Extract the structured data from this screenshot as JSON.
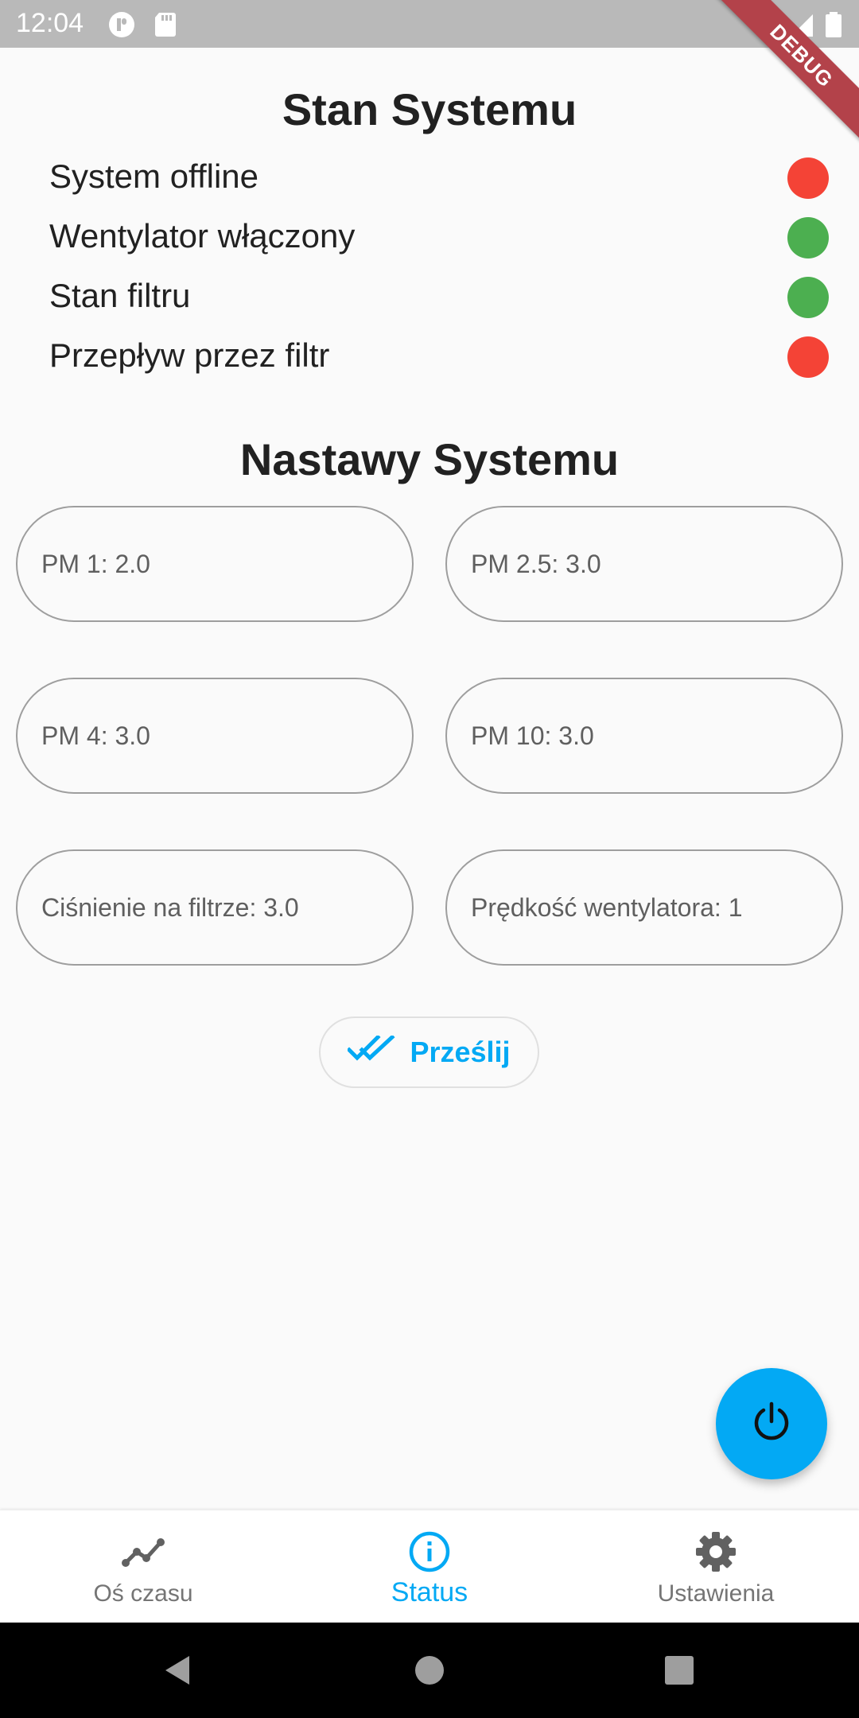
{
  "status_bar": {
    "time": "12:04",
    "icons": [
      "notification-app-icon",
      "sd-card-icon",
      "wifi-icon",
      "signal-icon",
      "battery-icon"
    ]
  },
  "debug_banner": "DEBUG",
  "status_section": {
    "title": "Stan Systemu",
    "items": [
      {
        "label": "System offline",
        "state_color": "#f44336"
      },
      {
        "label": "Wentylator włączony",
        "state_color": "#4caf50"
      },
      {
        "label": "Stan filtru",
        "state_color": "#4caf50"
      },
      {
        "label": "Przepływ przez filtr",
        "state_color": "#f44336"
      }
    ]
  },
  "setpoints_section": {
    "title": "Nastawy Systemu",
    "fields": [
      {
        "label": "PM 1: 2.0"
      },
      {
        "label": "PM 2.5: 3.0"
      },
      {
        "label": "PM 4: 3.0"
      },
      {
        "label": "PM 10: 3.0"
      },
      {
        "label": "Ciśnienie na filtrze: 3.0"
      },
      {
        "label": "Prędkość wentylatora: 1"
      }
    ],
    "submit_label": "Prześlij"
  },
  "fab": {
    "icon": "power-icon"
  },
  "bottom_nav": {
    "items": [
      {
        "label": "Oś czasu",
        "icon": "timeline-icon"
      },
      {
        "label": "Status",
        "icon": "info-icon",
        "active": true
      },
      {
        "label": "Ustawienia",
        "icon": "gear-icon"
      }
    ]
  },
  "colors": {
    "accent": "#03a9f4",
    "status_on": "#4caf50",
    "status_off": "#f44336"
  }
}
